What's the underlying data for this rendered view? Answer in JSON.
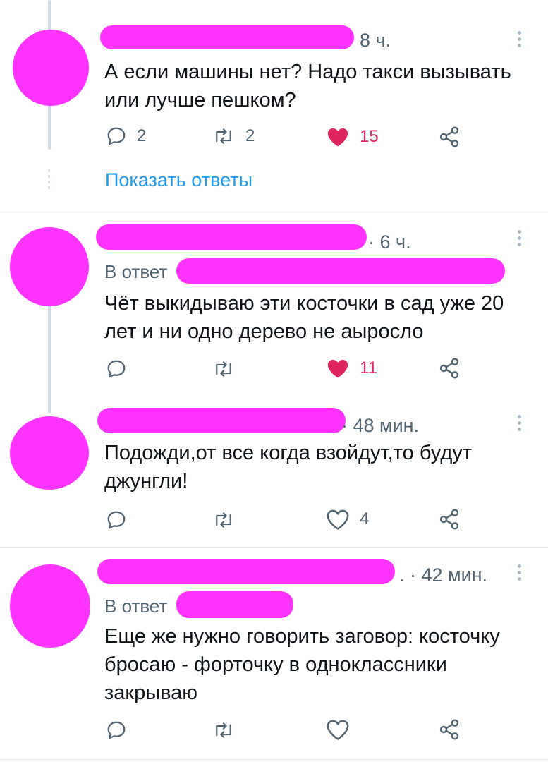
{
  "colors": {
    "accent": "#1d9bf0",
    "like": "#e0245e",
    "muted": "#536471",
    "redaction": "#ff33ff"
  },
  "icons": {
    "reply": "comment-bubble-icon",
    "retweet": "retweet-icon",
    "like": "heart-icon",
    "share": "share-icon",
    "more": "vertical-dots-icon"
  },
  "tweets": [
    {
      "time": "8 ч.",
      "text": "А если машины нет? Надо такси вызывать или лучше пешком?",
      "replies": "2",
      "retweets": "2",
      "likes": "15",
      "liked": true,
      "show_replies": "Показать ответы"
    },
    {
      "time": "· 6 ч.",
      "reply_to": "В ответ",
      "text": "Чёт выкидываю эти косточки в сад уже 20 лет и ни одно дерево не аыросло",
      "replies": "",
      "retweets": "",
      "likes": "11",
      "liked": true
    },
    {
      "time": "· 48 мин.",
      "text": "Подожди,от все когда взойдут,то будут джунгли!",
      "replies": "",
      "retweets": "",
      "likes": "4",
      "liked": false
    },
    {
      "time": ". · 42 мин.",
      "reply_to": "В ответ",
      "text": "Еще же нужно говорить заговор: косточку бросаю - форточку в одноклассники закрываю",
      "replies": "",
      "retweets": "",
      "likes": "",
      "liked": false
    }
  ]
}
